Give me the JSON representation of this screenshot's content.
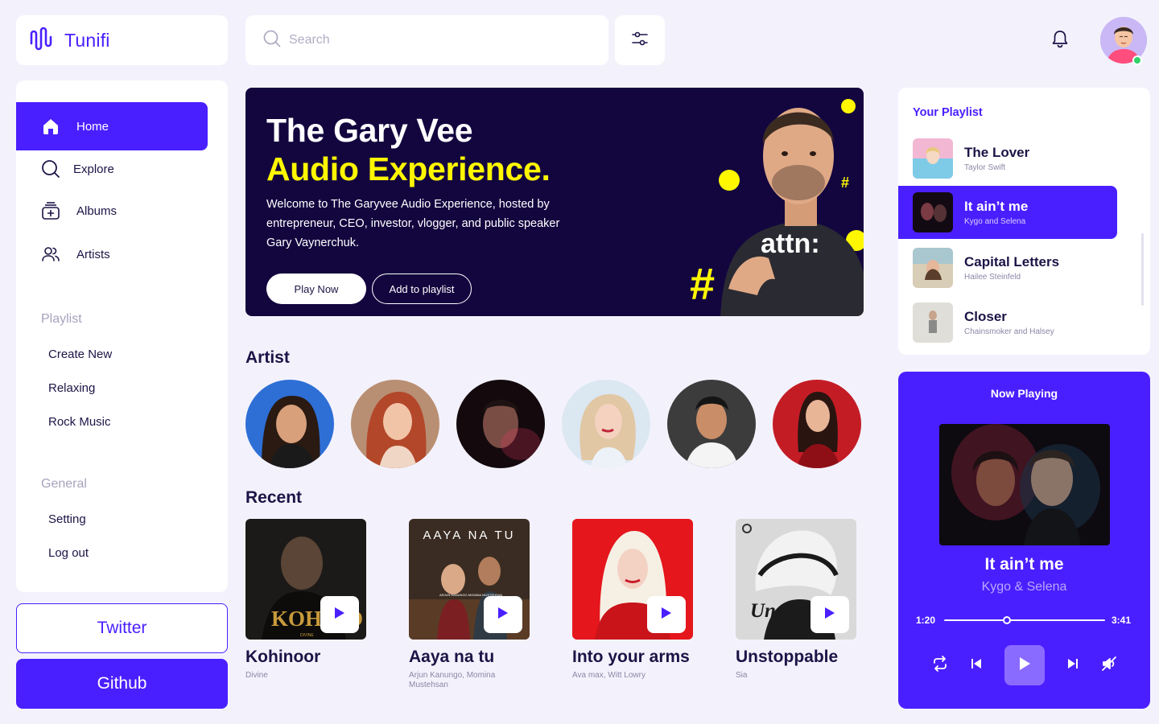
{
  "app": {
    "name": "Tunifi"
  },
  "search": {
    "placeholder": "Search"
  },
  "nav": [
    {
      "label": "Home",
      "icon": "home-icon",
      "active": true
    },
    {
      "label": "Explore",
      "icon": "search-icon"
    },
    {
      "label": "Albums",
      "icon": "album-icon"
    },
    {
      "label": "Artists",
      "icon": "users-icon"
    }
  ],
  "playlist_section": {
    "title": "Playlist",
    "items": [
      "Create New",
      "Relaxing",
      "Rock Music"
    ]
  },
  "general_section": {
    "title": "General",
    "items": [
      "Setting",
      "Log out"
    ]
  },
  "buttons": {
    "twitter": "Twitter",
    "github": "Github"
  },
  "hero": {
    "title_line1": "The Gary Vee",
    "title_line2": "Audio Experience.",
    "description": "Welcome to The Garyvee Audio Experience, hosted by entrepreneur, CEO, investor, vlogger, and public speaker Gary Vaynerchuk.",
    "play_label": "Play Now",
    "add_label": "Add to playlist",
    "shirt_text": "attn:",
    "hash_glyph": "#"
  },
  "artist_section": {
    "title": "Artist"
  },
  "recent_section": {
    "title": "Recent"
  },
  "recent": [
    {
      "title": "Kohinoor",
      "artist": "Divine",
      "cover_text": "KOHINO",
      "cover_sub": "DIVINE"
    },
    {
      "title": "Aaya na tu",
      "artist": "Arjun Kanungo, Momina Mustehsan",
      "cover_text": "AAYA NA TU",
      "cover_sub": "ARJUN KANUNGO MOMINA MUSTEHSAN"
    },
    {
      "title": "Into your arms",
      "artist": "Ava max, Witt Lowry"
    },
    {
      "title": "Unstoppable",
      "artist": "Sia",
      "cover_text": "Unstopp",
      "cover_sub": "Sia"
    }
  ],
  "your_playlist": {
    "title": "Your Playlist",
    "items": [
      {
        "title": "The Lover",
        "artist": "Taylor Swift"
      },
      {
        "title": "It ain’t me",
        "artist": "Kygo and Selena",
        "active": true
      },
      {
        "title": "Capital Letters",
        "artist": "Hailee Steinfeld"
      },
      {
        "title": "Closer",
        "artist": "Chainsmoker and Halsey"
      }
    ]
  },
  "now_playing": {
    "header": "Now Playing",
    "title": "It ain’t me",
    "artist": "Kygo & Selena",
    "elapsed": "1:20",
    "duration": "3:41",
    "progress": 0.39
  },
  "colors": {
    "accent": "#4a1fff",
    "hero_bg": "#13063f",
    "hero_yellow": "#fff700",
    "page_bg": "#f3f2fc"
  }
}
